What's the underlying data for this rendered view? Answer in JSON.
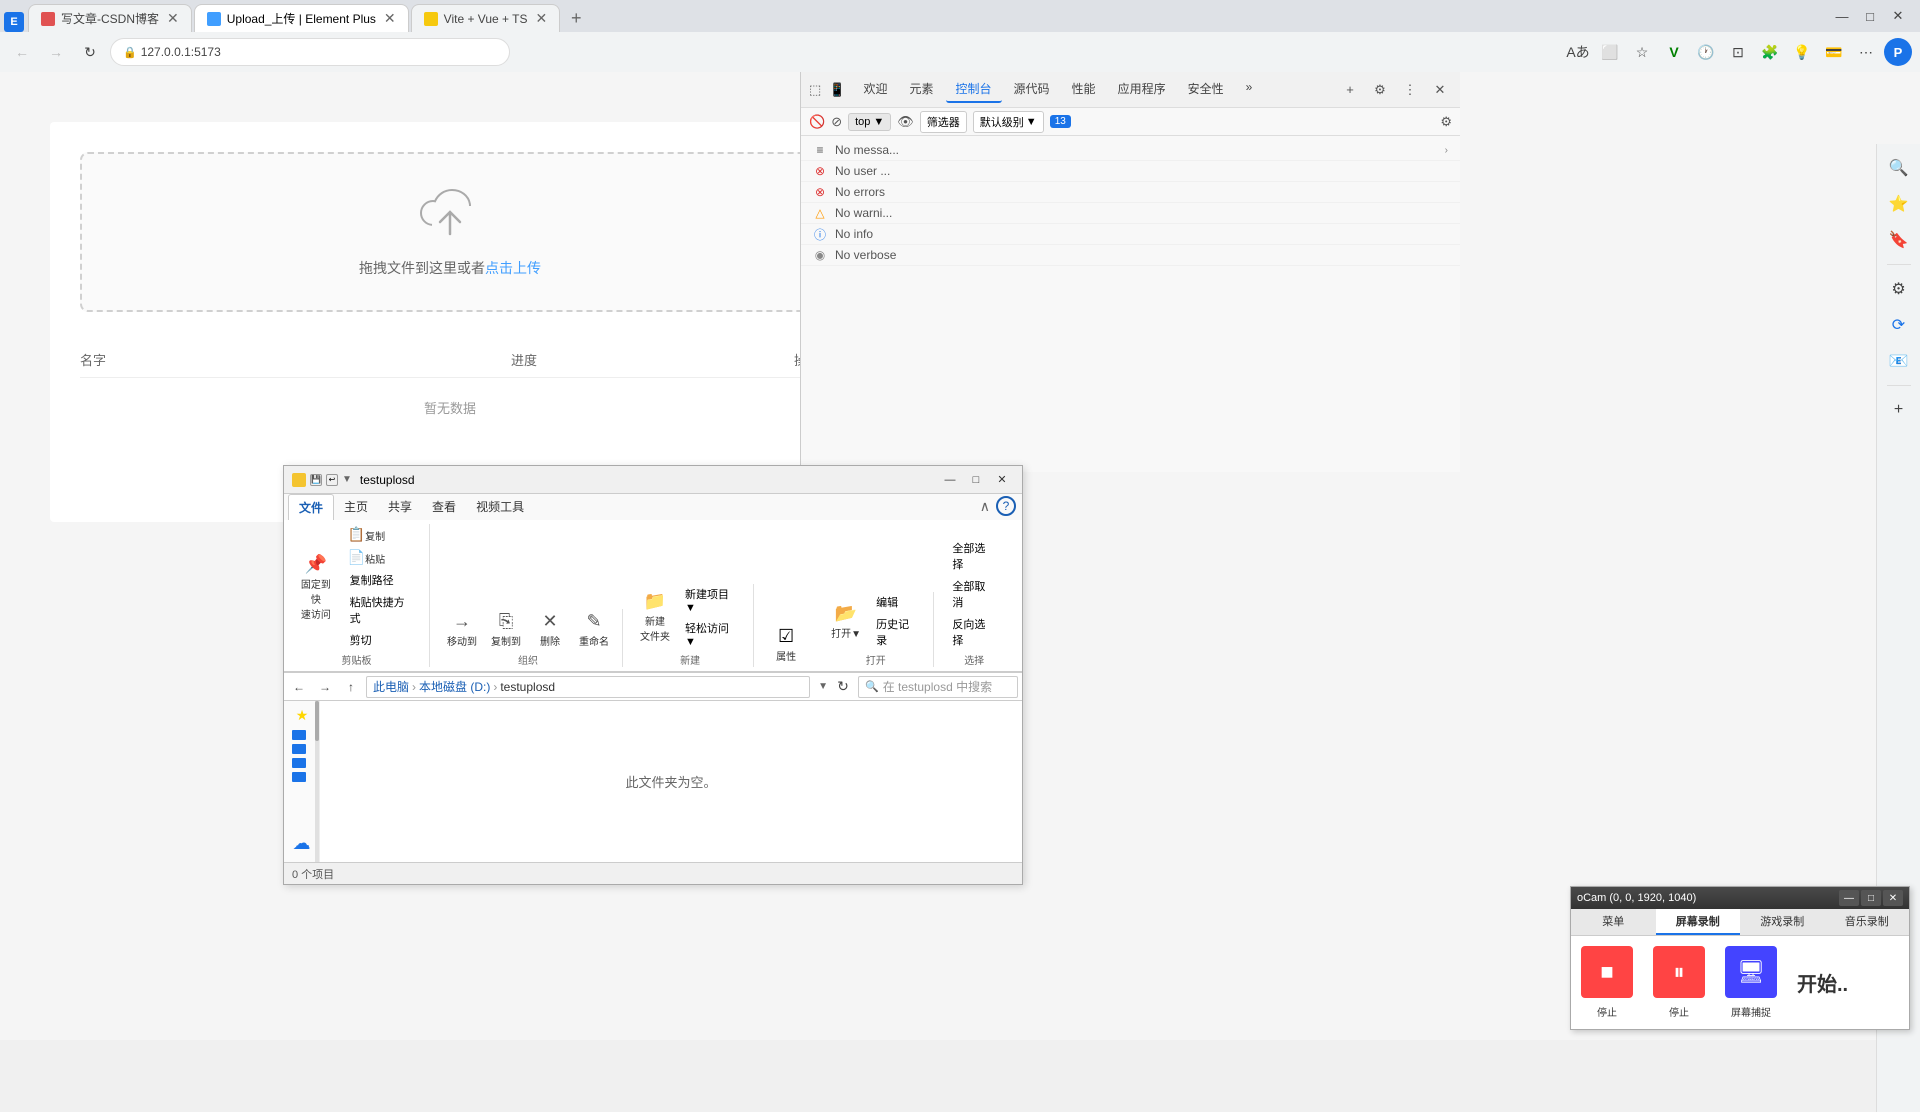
{
  "browser": {
    "tabs": [
      {
        "id": "csdn",
        "label": "写文章-CSDN博客",
        "favicon_color": "#e05252",
        "active": false
      },
      {
        "id": "upload",
        "label": "Upload_上传 | Element Plus",
        "favicon_color": "#409eff",
        "active": true
      },
      {
        "id": "vite",
        "label": "Vite + Vue + TS",
        "favicon_color": "#f6c90e",
        "active": false
      }
    ],
    "address": "127.0.0.1:5173",
    "new_tab_label": "+",
    "win_min": "—",
    "win_max": "□",
    "win_close": "✕"
  },
  "toolbar": {
    "back": "←",
    "forward": "→",
    "refresh": "↻",
    "home": "⌂"
  },
  "upload_page": {
    "cloud_icon": "☁",
    "upload_hint": "拖拽文件到这里或者",
    "upload_link": "点击上传",
    "table_headers": [
      "名字",
      "进度",
      "操作"
    ],
    "empty_text": "暂无数据"
  },
  "devtools": {
    "panel_tabs": [
      "元素",
      "控制台",
      "源代码",
      "性能",
      "应用程序",
      "安全性"
    ],
    "active_tab": "控制台",
    "welcome": "欢迎",
    "more_tabs": "»",
    "top_selector": "top",
    "filter_placeholder": "筛选器",
    "default_levels": "默认级别",
    "badge_count": "13",
    "close": "✕",
    "settings_icon": "⚙",
    "dock_icon": "⊞",
    "more_icon": "⋮",
    "console_items": [
      {
        "id": "messages",
        "icon": "≡",
        "icon_type": "message",
        "text": "No messa..."
      },
      {
        "id": "user",
        "icon": "⊗",
        "icon_type": "user",
        "text": "No user ..."
      },
      {
        "id": "errors",
        "icon": "⊗",
        "icon_type": "error",
        "text": "No errors"
      },
      {
        "id": "warnings",
        "icon": "△",
        "icon_type": "warn",
        "text": "No warni..."
      },
      {
        "id": "info",
        "icon": "ⓘ",
        "icon_type": "info",
        "text": "No info"
      },
      {
        "id": "verbose",
        "icon": "◉",
        "icon_type": "verbose",
        "text": "No verbose"
      }
    ]
  },
  "file_explorer": {
    "title": "testuplosd",
    "ribbon_tabs": [
      "文件",
      "主页",
      "共享",
      "查看",
      "视频工具"
    ],
    "active_tab": "文件",
    "ribbon_groups": {
      "clipboard": {
        "label": "剪贴板",
        "buttons": [
          {
            "icon": "📌",
            "label": "固定到快\n速访问"
          },
          {
            "icon": "📋",
            "label": "复制"
          },
          {
            "icon": "📄",
            "label": "粘贴"
          }
        ],
        "small_buttons": [
          "复制路径",
          "粘贴快捷方式",
          "剪切"
        ]
      },
      "organize": {
        "label": "组织",
        "buttons": [
          {
            "icon": "→",
            "label": "移动到"
          },
          {
            "icon": "⎘",
            "label": "复制到"
          },
          {
            "icon": "✕",
            "label": "删除"
          },
          {
            "icon": "✎",
            "label": "重命名"
          }
        ]
      },
      "new": {
        "label": "新建",
        "buttons": [
          {
            "icon": "📁",
            "label": "新建\n文件夹"
          }
        ],
        "small_buttons": [
          "新建项目▼",
          "轻松访问▼"
        ]
      },
      "open": {
        "label": "打开",
        "buttons": [
          {
            "icon": "📂",
            "label": "打开▼"
          },
          {
            "icon": "✎",
            "label": "编辑"
          }
        ],
        "small_buttons": [
          "历史记录"
        ]
      },
      "select": {
        "label": "选择",
        "buttons": [
          {
            "icon": "☑",
            "label": "全部选择"
          },
          {
            "icon": "☐",
            "label": "全部取消"
          },
          {
            "icon": "⇄",
            "label": "反向选择"
          }
        ]
      }
    },
    "breadcrumb": {
      "items": [
        "此电脑",
        "本地磁盘 (D:)",
        "testuplosd"
      ],
      "separator": "›"
    },
    "search_placeholder": "在 testuplosd 中搜索",
    "empty_folder_text": "此文件夹为空。",
    "status": "0 个项目",
    "win_min": "—",
    "win_max": "□",
    "win_close": "✕"
  },
  "ocam": {
    "title": "oCam (0, 0, 1920, 1040)",
    "tabs": [
      "菜单",
      "屏幕录制",
      "游戏录制",
      "音乐录制"
    ],
    "active_tab": "屏幕录制",
    "stop_label": "停止",
    "pause_label": "停止",
    "screen_label": "屏幕捕捉",
    "start_label": "开始..",
    "win_min": "—",
    "win_max": "□",
    "win_close": "✕"
  },
  "right_sidebar": {
    "icons": [
      "🔍",
      "⭐",
      "🔖",
      "⚙",
      "🔄",
      "📱",
      "→"
    ]
  }
}
